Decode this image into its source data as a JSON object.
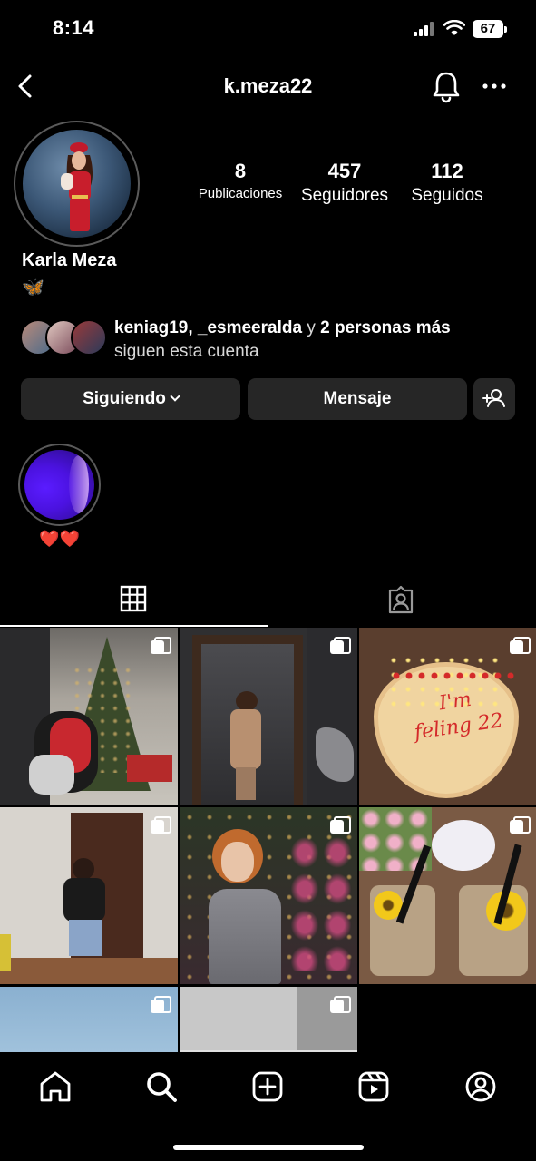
{
  "status_bar": {
    "time": "8:14",
    "battery": "67",
    "icons": [
      "signal-icon",
      "wifi-icon",
      "battery-icon"
    ]
  },
  "header": {
    "username": "k.meza22",
    "icons": [
      "back-icon",
      "bell-icon",
      "more-icon"
    ]
  },
  "profile": {
    "full_name": "Karla Meza",
    "bio": "🦋",
    "stats": {
      "posts_count": "8",
      "posts_label": "Publicaciones",
      "followers_count": "457",
      "followers_label": "Seguidores",
      "following_count": "112",
      "following_label": "Seguidos"
    }
  },
  "followed_by": {
    "names": "keniag19, _esmeeralda",
    "connector": "y",
    "others": "2 personas más",
    "suffix": "siguen esta cuenta"
  },
  "actions": {
    "following_label": "Siguiendo",
    "message_label": "Mensaje",
    "add_user_icon": "add-user-icon"
  },
  "highlights": [
    {
      "title": "❤️❤️"
    }
  ],
  "tabs": [
    "grid-icon",
    "tagged-icon"
  ],
  "posts": [
    {
      "description_icon": "multiple-photos-icon"
    },
    {
      "description_icon": "multiple-photos-icon"
    },
    {
      "description_icon": "multiple-photos-icon",
      "text": "I'm feling 22"
    },
    {
      "description_icon": "multiple-photos-icon"
    },
    {
      "description_icon": "multiple-photos-icon"
    },
    {
      "description_icon": "multiple-photos-icon"
    },
    {
      "description_icon": "multiple-photos-icon"
    },
    {
      "description_icon": "multiple-photos-icon"
    }
  ],
  "bottom_nav": [
    "home-icon",
    "search-icon",
    "create-icon",
    "reels-icon",
    "profile-icon"
  ],
  "colors": {
    "background": "#000000",
    "button": "#262626",
    "highlight_ring": "#5a5a5a"
  }
}
